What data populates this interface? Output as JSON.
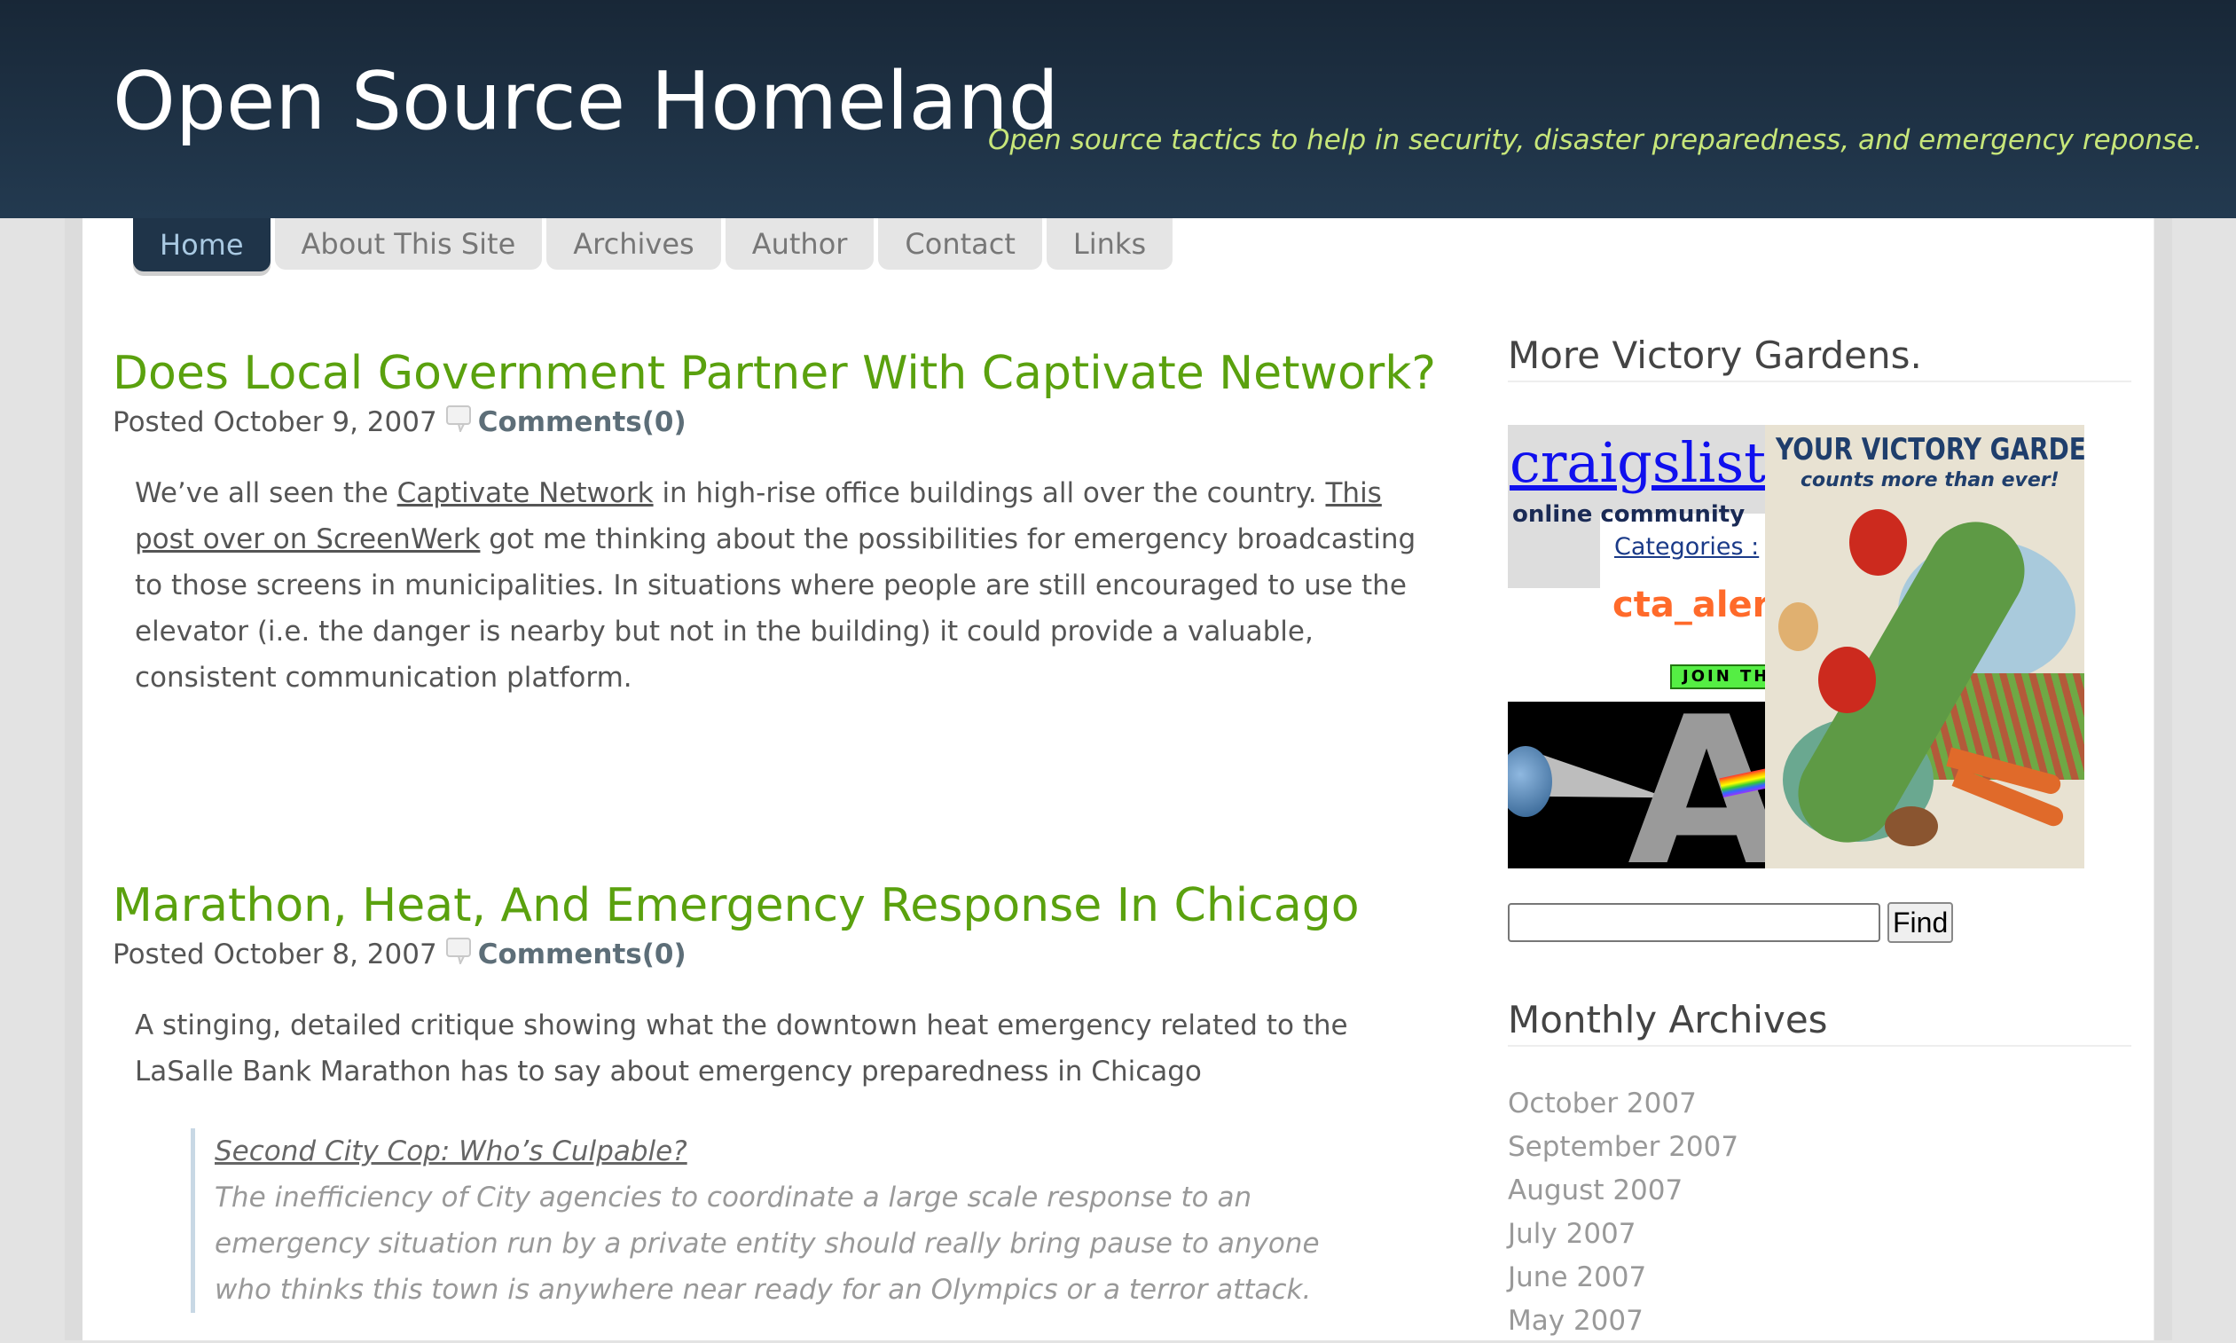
{
  "header": {
    "site_title": "Open Source Homeland",
    "tagline": "Open source tactics to help in security, disaster preparedness, and emergency reponse."
  },
  "nav": {
    "tabs": [
      {
        "label": "Home",
        "active": true
      },
      {
        "label": "About This Site",
        "active": false
      },
      {
        "label": "Archives",
        "active": false
      },
      {
        "label": "Author",
        "active": false
      },
      {
        "label": "Contact",
        "active": false
      },
      {
        "label": "Links",
        "active": false
      }
    ]
  },
  "posts": [
    {
      "title": "Does Local Government Partner With Captivate Network?",
      "posted": "Posted October 9, 2007",
      "comments": "Comments(0)",
      "body": {
        "t1": "We’ve all seen the ",
        "link1": "Captivate Network",
        "t2": " in high-rise office buildings all over the country. ",
        "link2": "This post over on ScreenWerk",
        "t3": " got me thinking about the possibilities for emergency broadcasting to those screens in municipalities. In situations where people are still encouraged to use the elevator (i.e. the danger is nearby but not in the building) it could provide a valuable, consistent communication platform."
      }
    },
    {
      "title": "Marathon, Heat, And Emergency Response In Chicago",
      "posted": "Posted October 8, 2007",
      "comments": "Comments(0)",
      "body": "A stinging, detailed critique showing what the downtown heat emergency related to the LaSalle Bank Marathon has to say about emergency preparedness in Chicago",
      "quote": {
        "link": "Second City Cop: Who’s Culpable?",
        "text": "The inefficiency of City agencies to coordinate a large scale response to an emergency situation run by a private entity should really bring pause to anyone who thinks this town is anywhere near ready for an Olympics or a terror attack."
      }
    }
  ],
  "sidebar": {
    "gallery_title": "More Victory Gardens.",
    "gallery": {
      "craigslist_logo": "craigslist",
      "craigslist_community": "online community",
      "craigslist_categories": "Categories :",
      "craigslist_cta": "cta_aler",
      "craigslist_join": "JOIN TH",
      "poster_title": "YOUR VICTORY GARDEN",
      "poster_sub": "counts more than ever!"
    },
    "search": {
      "value": "",
      "button": "Find"
    },
    "archives_title": "Monthly Archives",
    "archives": [
      "October 2007",
      "September 2007",
      "August 2007",
      "July 2007",
      "June 2007",
      "May 2007"
    ]
  },
  "colors": {
    "header_bg": "#1f3449",
    "title_green": "#5aa10e",
    "tagline_green": "#c7e67a",
    "active_tab_text": "#a9c9e2"
  }
}
